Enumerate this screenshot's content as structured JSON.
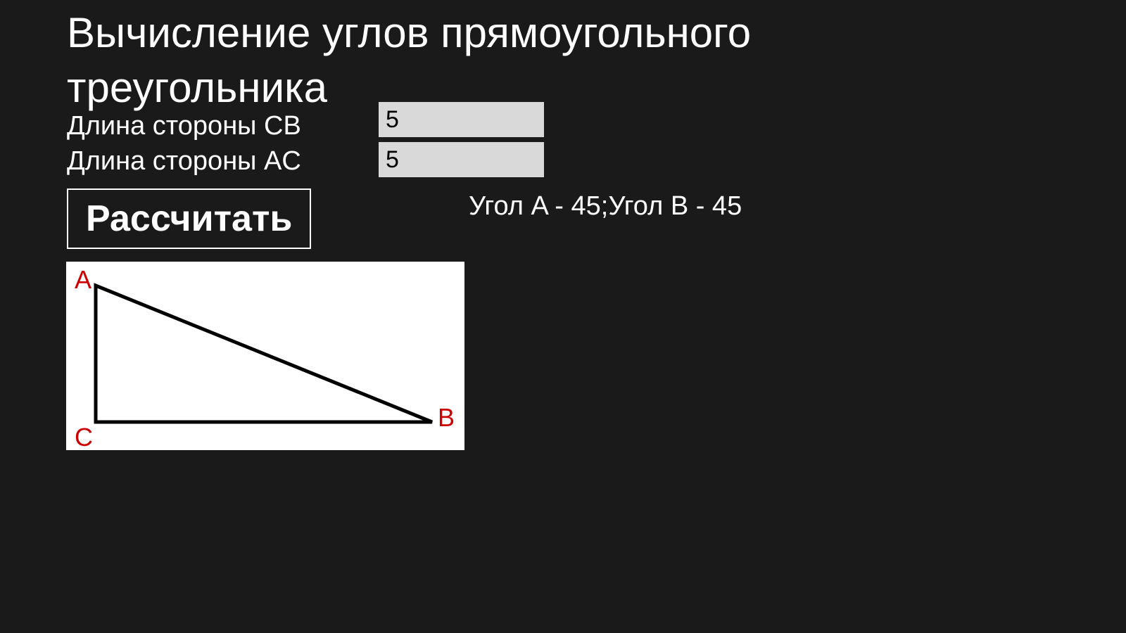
{
  "title": "Вычисление углов прямоугольного треугольника",
  "labels": {
    "cb": "Длина стороны CB",
    "ac": "Длина стороны AC"
  },
  "inputs": {
    "cb": "5",
    "ac": "5"
  },
  "button": "Рассчитать",
  "result": "Угол A - 45;Угол B - 45",
  "diagram": {
    "A": "A",
    "B": "B",
    "C": "C"
  }
}
